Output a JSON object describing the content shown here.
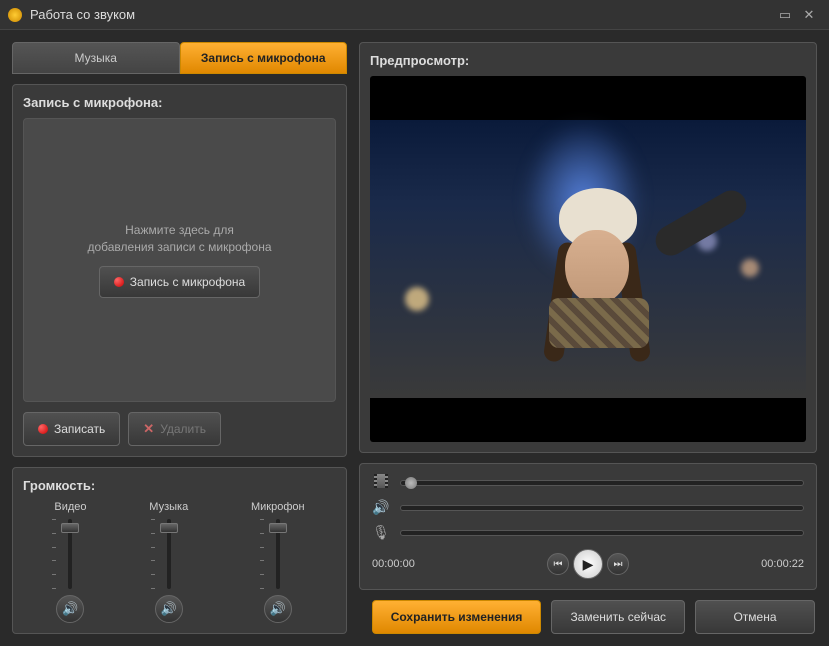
{
  "titlebar": {
    "title": "Работа со звуком"
  },
  "tabs": {
    "music": "Музыка",
    "mic": "Запись с микрофона"
  },
  "record": {
    "heading": "Запись с микрофона:",
    "hint1": "Нажмите здесь для",
    "hint2": "добавления записи с микрофона",
    "btn_record_mic": "Запись с микрофона",
    "btn_record": "Записать",
    "btn_delete": "Удалить"
  },
  "volume": {
    "heading": "Громкость:",
    "video": "Видео",
    "music": "Музыка",
    "mic": "Микрофон"
  },
  "preview": {
    "heading": "Предпросмотр:",
    "time_current": "00:00:00",
    "time_total": "00:00:22"
  },
  "footer": {
    "save": "Сохранить изменения",
    "replace": "Заменить сейчас",
    "cancel": "Отмена"
  }
}
